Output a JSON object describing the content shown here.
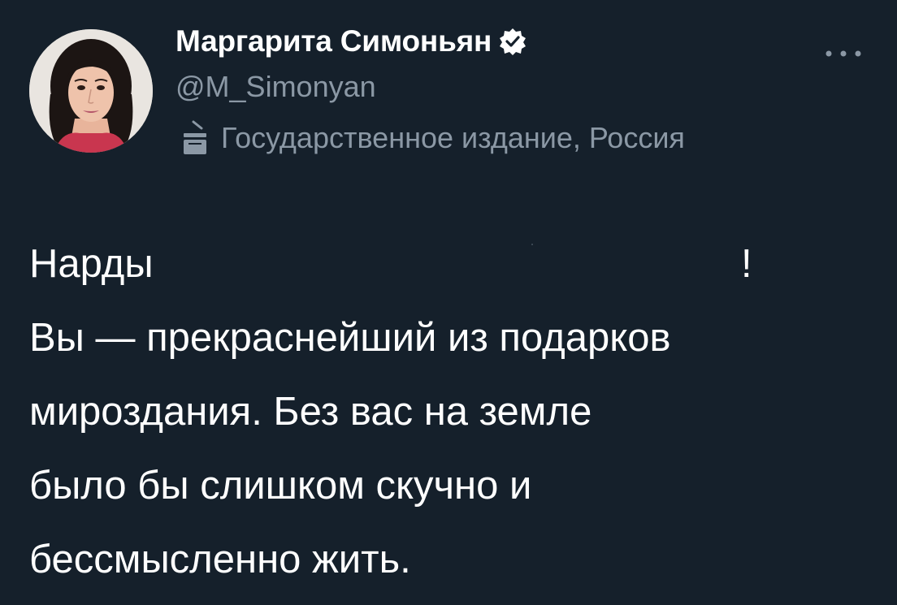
{
  "author": {
    "display_name": "Маргарита Симоньян",
    "handle": "@M_Simonyan",
    "label": "Государственное издание, Россия",
    "verified_icon": "verified-badge-icon",
    "label_icon": "government-podium-icon",
    "avatar_alt": "avatar"
  },
  "menu": {
    "icon": "more-options-icon"
  },
  "tweet": {
    "lines": [
      "Нарды",
      "Вы — прекраснейший из подарков",
      "мироздания. Без вас на земле",
      "было бы слишком скучно и",
      "бессмысленно жить."
    ],
    "exclamation": "!"
  },
  "colors": {
    "background": "#15202b",
    "primary_text": "#ffffff",
    "secondary_text": "#8b98a5"
  }
}
